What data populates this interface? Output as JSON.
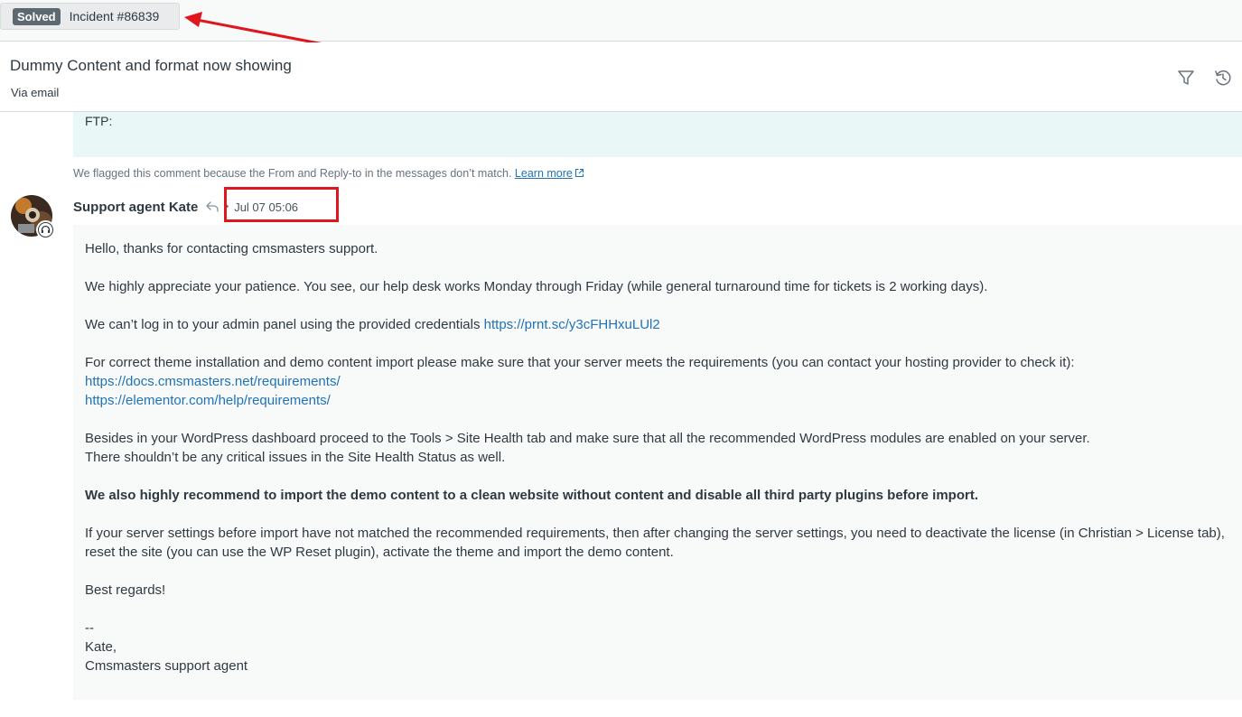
{
  "tab": {
    "status": "Solved",
    "title": "Incident #86839"
  },
  "header": {
    "subject": "Dummy Content and format now showing",
    "channel": "Via email"
  },
  "previous_comment": {
    "text": "FTP:"
  },
  "flag_note": {
    "text": "We flagged this comment because the From and Reply-to in the messages don’t match.",
    "link": "Learn more"
  },
  "comment": {
    "author": "Support agent Kate",
    "separator": "•",
    "time": "Jul 07 05:06",
    "greeting": "Hello, thanks for contacting cmsmasters support.",
    "patience": "We highly appreciate your patience. You see, our help desk works Monday through Friday (while general turnaround time for tickets is 2 working days).",
    "login_text": "We can’t log in to your admin panel using the provided credentials",
    "login_link": "https://prnt.sc/y3cFHHxuLUl2",
    "requirements_text": "For correct theme installation and demo content import please make sure that your server meets the requirements (you can contact your hosting provider to check it):",
    "requirements_link1": "https://docs.cmsmasters.net/requirements/",
    "requirements_link2": "https://elementor.com/help/requirements/",
    "health_line1": "Besides in your WordPress dashboard proceed to the Tools > Site Health tab and make sure that all the recommended WordPress modules are enabled on your server.",
    "health_line2": "There shouldn’t be any critical issues in the Site Health Status as well.",
    "recommend_bold": "We also highly recommend to import the demo content to a clean website without content and disable all third party plugins before import.",
    "server_settings": "If your server settings before import have not matched the recommended requirements, then after changing the server settings, you need to deactivate the license (in Christian > License tab), reset the site (you can use the WP Reset plugin), activate the theme and import the demo content.",
    "closing": "Best regards!",
    "sig_dash": "--",
    "sig_name": "Kate,",
    "sig_role": "Cmsmasters support agent"
  },
  "colors": {
    "link": "#1f73b7",
    "annotation": "#e0161f",
    "status_pill": "#5c6970"
  },
  "icons": [
    "filter-icon",
    "history-icon",
    "external-link-icon",
    "reply-icon",
    "headset-icon"
  ]
}
